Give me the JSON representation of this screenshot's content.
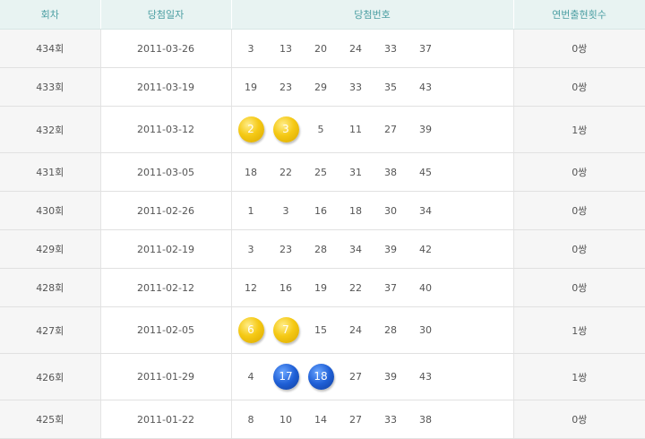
{
  "headers": {
    "round": "회차",
    "date": "당첨일자",
    "numbers": "당첨번호",
    "pairs": "연번출현횟수"
  },
  "colors": {
    "header_text": "#4c9fa3",
    "header_bg": "#e8f3f2",
    "ball_yellow": "#f5c915",
    "ball_blue": "#1f5fd6"
  },
  "rows": [
    {
      "round": "434회",
      "date": "2011-03-26",
      "pairs": "0쌍",
      "numbers": [
        {
          "v": "3",
          "ball": ""
        },
        {
          "v": "13",
          "ball": ""
        },
        {
          "v": "20",
          "ball": ""
        },
        {
          "v": "24",
          "ball": ""
        },
        {
          "v": "33",
          "ball": ""
        },
        {
          "v": "37",
          "ball": ""
        }
      ]
    },
    {
      "round": "433회",
      "date": "2011-03-19",
      "pairs": "0쌍",
      "numbers": [
        {
          "v": "19",
          "ball": ""
        },
        {
          "v": "23",
          "ball": ""
        },
        {
          "v": "29",
          "ball": ""
        },
        {
          "v": "33",
          "ball": ""
        },
        {
          "v": "35",
          "ball": ""
        },
        {
          "v": "43",
          "ball": ""
        }
      ]
    },
    {
      "round": "432회",
      "date": "2011-03-12",
      "pairs": "1쌍",
      "numbers": [
        {
          "v": "2",
          "ball": "yellow"
        },
        {
          "v": "3",
          "ball": "yellow"
        },
        {
          "v": "5",
          "ball": ""
        },
        {
          "v": "11",
          "ball": ""
        },
        {
          "v": "27",
          "ball": ""
        },
        {
          "v": "39",
          "ball": ""
        }
      ]
    },
    {
      "round": "431회",
      "date": "2011-03-05",
      "pairs": "0쌍",
      "numbers": [
        {
          "v": "18",
          "ball": ""
        },
        {
          "v": "22",
          "ball": ""
        },
        {
          "v": "25",
          "ball": ""
        },
        {
          "v": "31",
          "ball": ""
        },
        {
          "v": "38",
          "ball": ""
        },
        {
          "v": "45",
          "ball": ""
        }
      ]
    },
    {
      "round": "430회",
      "date": "2011-02-26",
      "pairs": "0쌍",
      "numbers": [
        {
          "v": "1",
          "ball": ""
        },
        {
          "v": "3",
          "ball": ""
        },
        {
          "v": "16",
          "ball": ""
        },
        {
          "v": "18",
          "ball": ""
        },
        {
          "v": "30",
          "ball": ""
        },
        {
          "v": "34",
          "ball": ""
        }
      ]
    },
    {
      "round": "429회",
      "date": "2011-02-19",
      "pairs": "0쌍",
      "numbers": [
        {
          "v": "3",
          "ball": ""
        },
        {
          "v": "23",
          "ball": ""
        },
        {
          "v": "28",
          "ball": ""
        },
        {
          "v": "34",
          "ball": ""
        },
        {
          "v": "39",
          "ball": ""
        },
        {
          "v": "42",
          "ball": ""
        }
      ]
    },
    {
      "round": "428회",
      "date": "2011-02-12",
      "pairs": "0쌍",
      "numbers": [
        {
          "v": "12",
          "ball": ""
        },
        {
          "v": "16",
          "ball": ""
        },
        {
          "v": "19",
          "ball": ""
        },
        {
          "v": "22",
          "ball": ""
        },
        {
          "v": "37",
          "ball": ""
        },
        {
          "v": "40",
          "ball": ""
        }
      ]
    },
    {
      "round": "427회",
      "date": "2011-02-05",
      "pairs": "1쌍",
      "numbers": [
        {
          "v": "6",
          "ball": "yellow"
        },
        {
          "v": "7",
          "ball": "yellow"
        },
        {
          "v": "15",
          "ball": ""
        },
        {
          "v": "24",
          "ball": ""
        },
        {
          "v": "28",
          "ball": ""
        },
        {
          "v": "30",
          "ball": ""
        }
      ]
    },
    {
      "round": "426회",
      "date": "2011-01-29",
      "pairs": "1쌍",
      "numbers": [
        {
          "v": "4",
          "ball": ""
        },
        {
          "v": "17",
          "ball": "blue"
        },
        {
          "v": "18",
          "ball": "blue"
        },
        {
          "v": "27",
          "ball": ""
        },
        {
          "v": "39",
          "ball": ""
        },
        {
          "v": "43",
          "ball": ""
        }
      ]
    },
    {
      "round": "425회",
      "date": "2011-01-22",
      "pairs": "0쌍",
      "numbers": [
        {
          "v": "8",
          "ball": ""
        },
        {
          "v": "10",
          "ball": ""
        },
        {
          "v": "14",
          "ball": ""
        },
        {
          "v": "27",
          "ball": ""
        },
        {
          "v": "33",
          "ball": ""
        },
        {
          "v": "38",
          "ball": ""
        }
      ]
    }
  ]
}
